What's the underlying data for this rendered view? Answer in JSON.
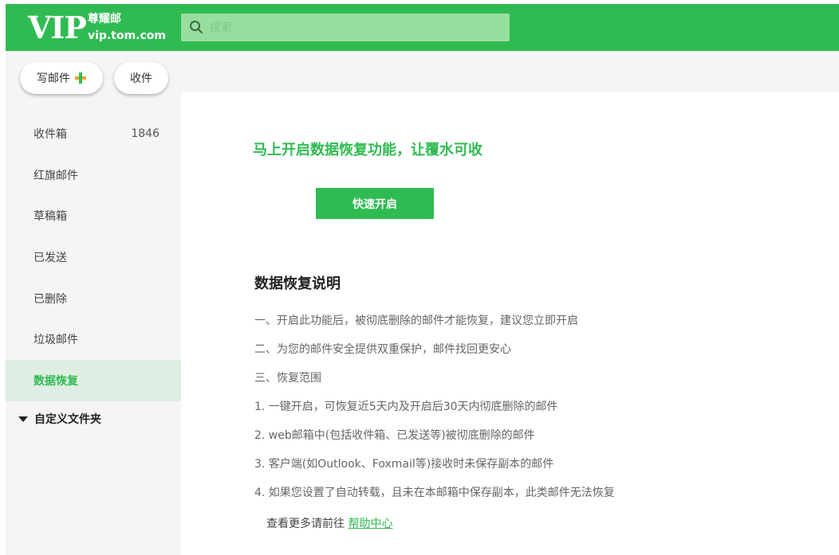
{
  "header": {
    "logo_main": "VIP",
    "logo_cn": "尊耀邮",
    "logo_domain": "vip.tom.com",
    "search_placeholder": "搜索"
  },
  "sidebar": {
    "compose_label": "写邮件",
    "receive_label": "收件",
    "folders": [
      {
        "label": "收件箱",
        "count": "1846"
      },
      {
        "label": "红旗邮件",
        "count": ""
      },
      {
        "label": "草稿箱",
        "count": ""
      },
      {
        "label": "已发送",
        "count": ""
      },
      {
        "label": "已删除",
        "count": ""
      },
      {
        "label": "垃圾邮件",
        "count": ""
      },
      {
        "label": "数据恢复",
        "count": ""
      }
    ],
    "custom_folder_label": "自定义文件夹"
  },
  "main": {
    "promo_title": "马上开启数据恢复功能，让覆水可收",
    "enable_button": "快速开启",
    "section_title": "数据恢复说明",
    "lines": [
      "一、开启此功能后，被彻底删除的邮件才能恢复，建议您立即开启",
      "二、为您的邮件安全提供双重保护，邮件找回更安心",
      "三、恢复范围",
      "1. 一键开启，可恢复近5天内及开启后30天内彻底删除的邮件",
      "2. web邮箱中(包括收件箱、已发送等)被彻底删除的邮件",
      "3. 客户端(如Outlook、Foxmail等)接收时未保存副本的邮件",
      "4. 如果您设置了自动转载，且未在本邮箱中保存副本，此类邮件无法恢复"
    ],
    "help_prefix": "查看更多请前往 ",
    "help_link": "帮助中心"
  },
  "colors": {
    "brand_green": "#30bb52",
    "search_bg": "#98de9f",
    "sidebar_bg": "#f5f5f5",
    "active_bg": "#dfeee2"
  }
}
